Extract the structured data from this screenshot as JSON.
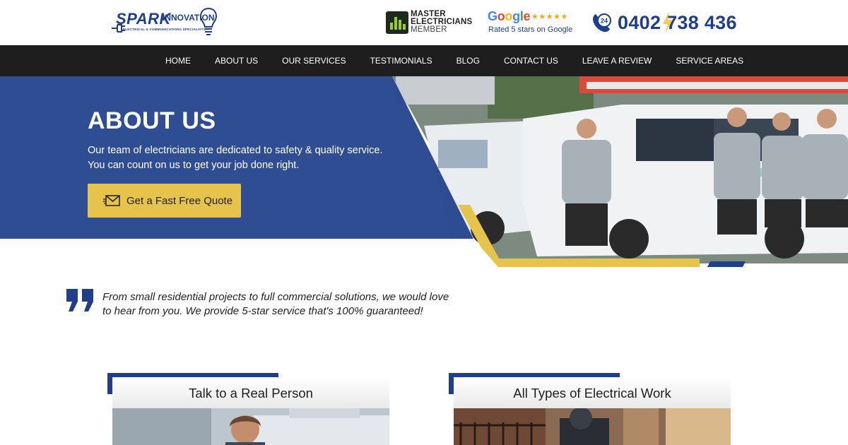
{
  "header": {
    "logo": {
      "name": "SPARK",
      "name2": "INNOVATION",
      "tagline": "ELECTRICAL & COMMUNICATIONS SPECIALISTS"
    },
    "master": {
      "line1": "MASTER",
      "line2": "ELECTRICIANS",
      "line3": "MEMBER"
    },
    "google": {
      "brand": "Google",
      "stars": "★★★★★",
      "rated": "Rated 5 stars on Google"
    },
    "phone": {
      "badge": "24",
      "number": "0402 738 436"
    }
  },
  "nav": {
    "items": [
      "HOME",
      "ABOUT US",
      "OUR SERVICES",
      "TESTIMONIALS",
      "BLOG",
      "CONTACT US",
      "LEAVE A REVIEW",
      "SERVICE AREAS"
    ]
  },
  "hero": {
    "title": "ABOUT US",
    "subtitle_line1": "Our team of electricians are dedicated to safety & quality service.",
    "subtitle_line2": "You can count on us to get your job done right.",
    "cta_label": "Get a Fast Free Quote"
  },
  "quote": {
    "text": "From small residential projects to full commercial solutions, we would love to hear from you. We provide 5-star service that's 100% guaranteed!"
  },
  "cards": [
    {
      "title": "Talk to a Real Person"
    },
    {
      "title": "All Types of Electrical Work"
    }
  ],
  "colors": {
    "brand_blue": "#1f3f8a",
    "accent_yellow": "#e6c34b",
    "nav_bg": "#1e1e1e"
  }
}
